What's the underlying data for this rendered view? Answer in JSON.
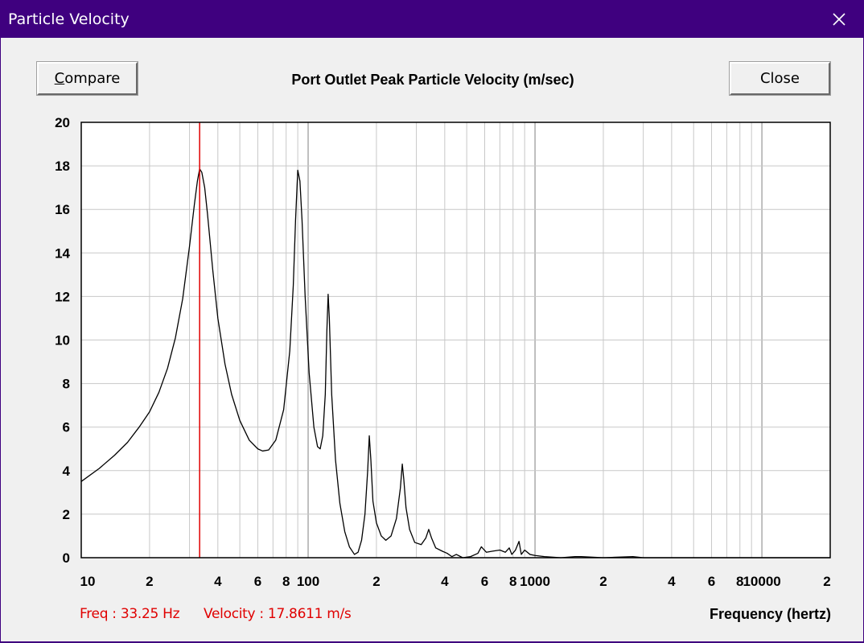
{
  "window": {
    "title": "Particle Velocity"
  },
  "toolbar": {
    "compare_label_first": "C",
    "compare_label_rest": "ompare",
    "close_label": "Close"
  },
  "status": {
    "freq": "Freq : 33.25 Hz",
    "velocity": "Velocity : 17.8611 m/s"
  },
  "colors": {
    "titlebar": "#3f007f",
    "curve": "#000000",
    "cursor": "#e00000",
    "grid": "#c8c8c8"
  },
  "chart_data": {
    "type": "line",
    "title": "Port Outlet Peak Particle Velocity (m/sec)",
    "xlabel": "Frequency (hertz)",
    "ylabel": "",
    "xscale": "log",
    "xlim": [
      10,
      20000
    ],
    "ylim": [
      0,
      20
    ],
    "yticks": [
      0,
      2,
      4,
      6,
      8,
      10,
      12,
      14,
      16,
      18,
      20
    ],
    "xtick_labels": [
      {
        "x": 10,
        "label": "10"
      },
      {
        "x": 20,
        "label": "2"
      },
      {
        "x": 40,
        "label": "4"
      },
      {
        "x": 60,
        "label": "6"
      },
      {
        "x": 80,
        "label": "8"
      },
      {
        "x": 100,
        "label": "100"
      },
      {
        "x": 200,
        "label": "2"
      },
      {
        "x": 400,
        "label": "4"
      },
      {
        "x": 600,
        "label": "6"
      },
      {
        "x": 800,
        "label": "8"
      },
      {
        "x": 1000,
        "label": "1000"
      },
      {
        "x": 2000,
        "label": "2"
      },
      {
        "x": 4000,
        "label": "4"
      },
      {
        "x": 6000,
        "label": "6"
      },
      {
        "x": 8000,
        "label": "8"
      },
      {
        "x": 10000,
        "label": "10000"
      },
      {
        "x": 20000,
        "label": "2"
      }
    ],
    "grid": true,
    "cursor": {
      "x": 33.25,
      "y": 17.8611
    },
    "series": [
      {
        "points": [
          [
            10,
            3.5
          ],
          [
            12,
            4.1
          ],
          [
            14,
            4.7
          ],
          [
            16,
            5.3
          ],
          [
            18,
            6.0
          ],
          [
            20,
            6.7
          ],
          [
            22,
            7.6
          ],
          [
            24,
            8.7
          ],
          [
            26,
            10.1
          ],
          [
            28,
            11.9
          ],
          [
            30,
            14.3
          ],
          [
            31.5,
            16.2
          ],
          [
            32.5,
            17.3
          ],
          [
            33.25,
            17.86
          ],
          [
            34,
            17.7
          ],
          [
            35,
            17.0
          ],
          [
            36,
            15.8
          ],
          [
            38,
            13.2
          ],
          [
            40,
            11.0
          ],
          [
            43,
            8.9
          ],
          [
            46,
            7.5
          ],
          [
            50,
            6.3
          ],
          [
            55,
            5.4
          ],
          [
            60,
            5.0
          ],
          [
            63,
            4.9
          ],
          [
            67,
            4.95
          ],
          [
            72,
            5.4
          ],
          [
            78,
            6.8
          ],
          [
            83,
            9.5
          ],
          [
            86,
            12.5
          ],
          [
            88,
            15.5
          ],
          [
            90,
            17.8
          ],
          [
            92,
            17.3
          ],
          [
            94,
            15.5
          ],
          [
            97,
            12.0
          ],
          [
            101,
            8.5
          ],
          [
            106,
            6.0
          ],
          [
            110,
            5.1
          ],
          [
            113,
            5.0
          ],
          [
            116,
            5.6
          ],
          [
            119,
            7.5
          ],
          [
            121,
            10.5
          ],
          [
            122.5,
            12.1
          ],
          [
            124,
            11.0
          ],
          [
            127,
            7.5
          ],
          [
            132,
            4.5
          ],
          [
            138,
            2.5
          ],
          [
            145,
            1.2
          ],
          [
            152,
            0.5
          ],
          [
            160,
            0.15
          ],
          [
            166,
            0.25
          ],
          [
            172,
            0.8
          ],
          [
            178,
            2.0
          ],
          [
            183,
            4.0
          ],
          [
            186,
            5.6
          ],
          [
            189,
            4.5
          ],
          [
            193,
            2.6
          ],
          [
            200,
            1.6
          ],
          [
            210,
            1.0
          ],
          [
            220,
            0.8
          ],
          [
            232,
            1.0
          ],
          [
            245,
            1.8
          ],
          [
            255,
            3.2
          ],
          [
            260,
            4.3
          ],
          [
            264,
            3.6
          ],
          [
            270,
            2.3
          ],
          [
            280,
            1.3
          ],
          [
            295,
            0.7
          ],
          [
            315,
            0.6
          ],
          [
            330,
            0.9
          ],
          [
            340,
            1.3
          ],
          [
            350,
            0.9
          ],
          [
            365,
            0.45
          ],
          [
            390,
            0.3
          ],
          [
            410,
            0.2
          ],
          [
            430,
            0.05
          ],
          [
            450,
            0.15
          ],
          [
            480,
            0.0
          ],
          [
            520,
            0.05
          ],
          [
            560,
            0.2
          ],
          [
            580,
            0.5
          ],
          [
            610,
            0.25
          ],
          [
            650,
            0.3
          ],
          [
            700,
            0.35
          ],
          [
            740,
            0.25
          ],
          [
            770,
            0.45
          ],
          [
            790,
            0.15
          ],
          [
            820,
            0.35
          ],
          [
            850,
            0.75
          ],
          [
            870,
            0.15
          ],
          [
            900,
            0.35
          ],
          [
            950,
            0.15
          ],
          [
            1000,
            0.1
          ],
          [
            1100,
            0.05
          ],
          [
            1300,
            0.0
          ],
          [
            1500,
            0.05
          ],
          [
            1600,
            0.05
          ],
          [
            2000,
            0.0
          ],
          [
            2700,
            0.05
          ],
          [
            3000,
            0.0
          ],
          [
            5000,
            0.0
          ],
          [
            20000,
            0.0
          ]
        ]
      }
    ]
  }
}
